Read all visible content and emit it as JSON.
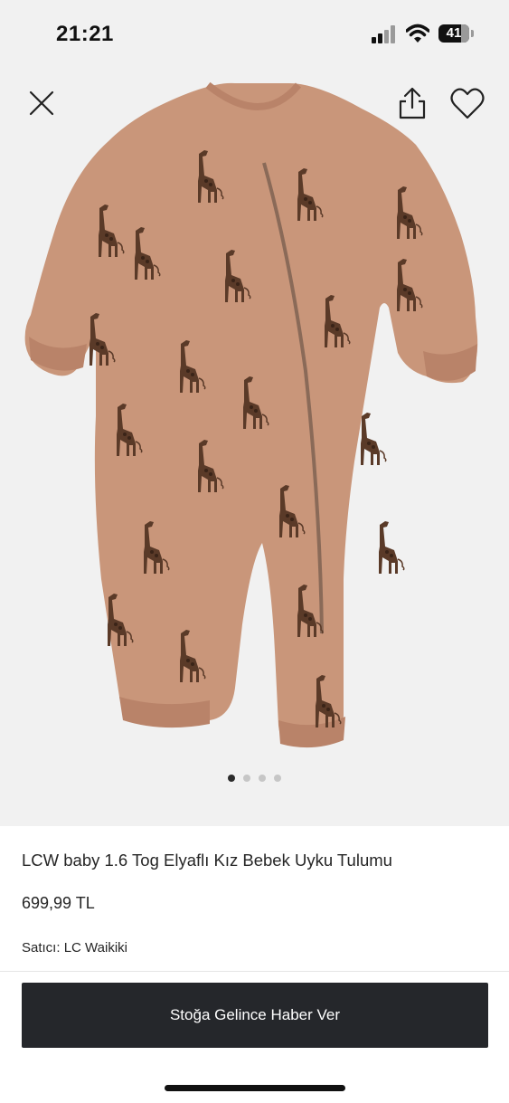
{
  "status_bar": {
    "time": "21:21",
    "battery_level": "41"
  },
  "gallery": {
    "image_count": 4,
    "active_index": 0,
    "product_color": "#c9967a",
    "print_color": "#5a3a28"
  },
  "product": {
    "title": "LCW baby 1.6 Tog Elyaflı Kız Bebek Uyku Tulumu",
    "price": "699,99 TL",
    "seller_label": "Satıcı:",
    "seller_name": "LC Waikiki"
  },
  "actions": {
    "notify_label": "Stoğa Gelince Haber Ver"
  },
  "icons": {
    "close": "close-icon",
    "share": "share-icon",
    "favorite": "heart-icon"
  }
}
